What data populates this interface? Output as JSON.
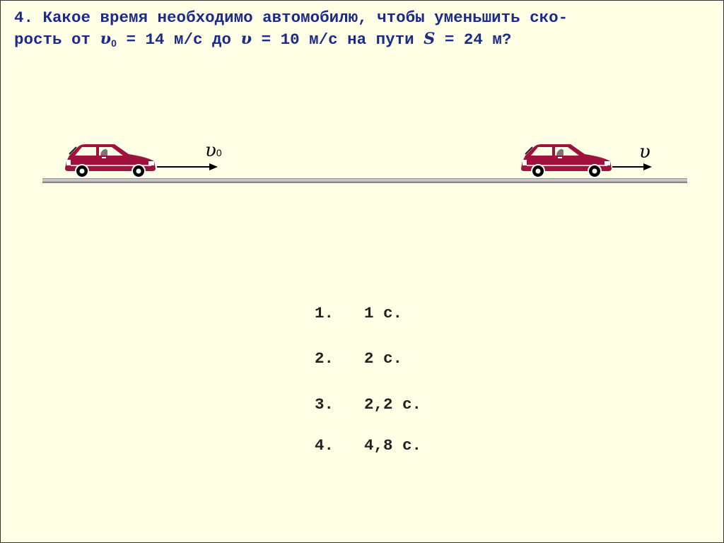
{
  "question": {
    "number": "4.",
    "line1": "Какое время необходимо автомобилю, чтобы уменьшить ско-",
    "line2_parts": {
      "prefix": "рость от ",
      "v0_symbol": "υ",
      "v0_sub": "0",
      "mid1": " = 14 м/с до ",
      "v_symbol": "υ",
      "mid2": " = 10 м/с на пути ",
      "s_symbol": "S",
      "suffix": " = 24 м?"
    }
  },
  "diagram": {
    "left_car_label": "υ",
    "left_car_label_sub": "0",
    "right_car_label": "υ",
    "car_color": "#a0123c",
    "text_color": "#1c2a8c",
    "background_color": "#ffffe6"
  },
  "answers": [
    {
      "number": "1.",
      "text": "1 с."
    },
    {
      "number": "2.",
      "text": "2 с."
    },
    {
      "number": "3.",
      "text": "2,2 с."
    },
    {
      "number": "4.",
      "text": "4,8 с."
    }
  ]
}
